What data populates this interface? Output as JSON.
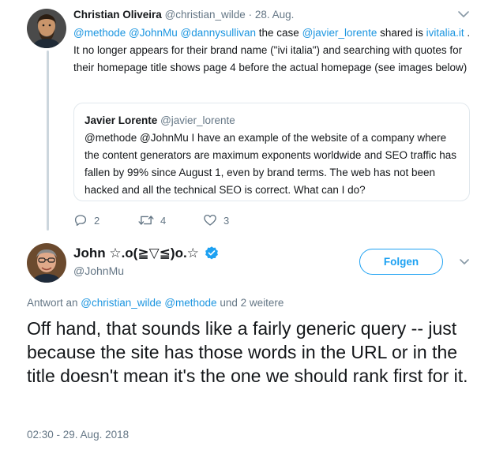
{
  "tweet1": {
    "author_name": "Christian Oliveira",
    "author_handle": "@christian_wilde",
    "separator": "·",
    "date": "28. Aug.",
    "body": {
      "m1": "@methode",
      "m2": "@JohnMu",
      "m3": "@dannysullivan",
      "t1": " the case ",
      "m4": "@javier_lorente",
      "t2": " shared is ",
      "link": "ivitalia.it",
      "t3": " . It no longer appears for their brand name (\"ivi italia\") and searching with quotes for their homepage title shows page 4 before the actual homepage (see images below)"
    },
    "quote": {
      "author_name": "Javier Lorente",
      "author_handle": "@javier_lorente",
      "text": "@methode @JohnMu I have an example of the website of a company where the content generators are maximum exponents worldwide and SEO traffic has fallen by 99% since August 1, even by brand terms. The web has not been hacked and all the technical SEO is correct. What can I do?"
    },
    "actions": {
      "replies": "2",
      "retweets": "4",
      "likes": "3"
    },
    "icons": {
      "avatar": "avatar-icon",
      "more": "chevron-down-icon",
      "reply": "reply-icon",
      "retweet": "retweet-icon",
      "like": "heart-icon"
    }
  },
  "tweet2": {
    "author_name": "John ☆.o(≧▽≦)o.☆",
    "author_handle": "@JohnMu",
    "follow_label": "Folgen",
    "replying_prefix": "Antwort an ",
    "replying_m1": "@christian_wilde",
    "replying_m2": "@methode",
    "replying_suffix": " und 2 weitere",
    "text": "Off hand, that sounds like a fairly generic query -- just because the site has those words in the URL or in the title doesn't mean it's the one we should rank first for it.",
    "timestamp": "02:30 - 29. Aug. 2018",
    "icons": {
      "avatar": "avatar-icon",
      "verified": "verified-badge-icon",
      "more": "chevron-down-icon"
    }
  },
  "colors": {
    "link": "#1b95e0",
    "secondary_text": "#657786",
    "primary_text": "#14171a",
    "brand_blue": "#1da1f2",
    "border": "#e1e8ed",
    "thread_line": "#ccd6dd"
  }
}
